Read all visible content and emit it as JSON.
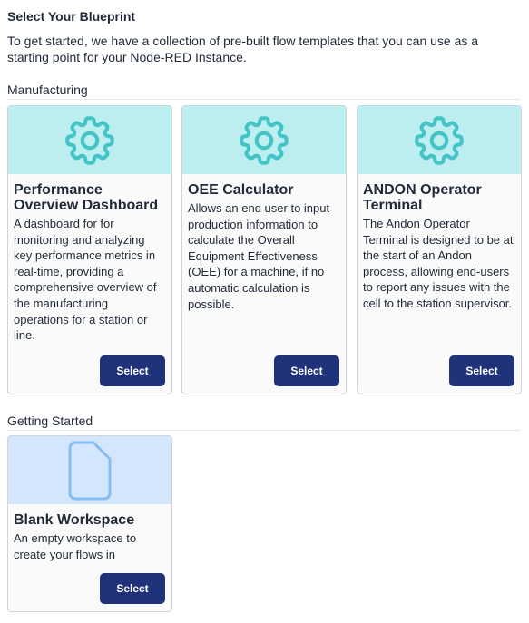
{
  "page": {
    "title": "Select Your Blueprint",
    "intro": "To get started, we have a collection of pre-built flow templates that you can use as a starting point for your Node-RED Instance."
  },
  "sections": [
    {
      "heading": "Manufacturing",
      "cards": [
        {
          "icon": "gear-icon",
          "title": "Performance Overview Dashboard",
          "description": "A dashboard for for monitoring and analyzing key performance metrics in real-time, providing a comprehensive overview of the manufacturing operations for a station or line.",
          "button": "Select"
        },
        {
          "icon": "gear-icon",
          "title": "OEE Calculator",
          "description": "Allows an end user to input production information to calculate the Overall Equipment Effectiveness (OEE) for a machine, if no automatic calculation is possible.",
          "button": "Select"
        },
        {
          "icon": "gear-icon",
          "title": "ANDON Operator Terminal",
          "description": "The Andon Operator Terminal is designed to be at the start of an Andon process, allowing end-users to report any issues with the cell to the station supervisor.",
          "button": "Select"
        }
      ]
    },
    {
      "heading": "Getting Started",
      "cards": [
        {
          "icon": "document-icon",
          "title": "Blank Workspace",
          "description": "An empty workspace to create your flows in",
          "button": "Select"
        }
      ]
    }
  ],
  "colors": {
    "banner_teal": "#bdeff0",
    "gear_stroke": "#45c4c8",
    "banner_blue": "#d4e6fb",
    "document_stroke": "#86bdf3",
    "button_bg": "#1f327a"
  }
}
